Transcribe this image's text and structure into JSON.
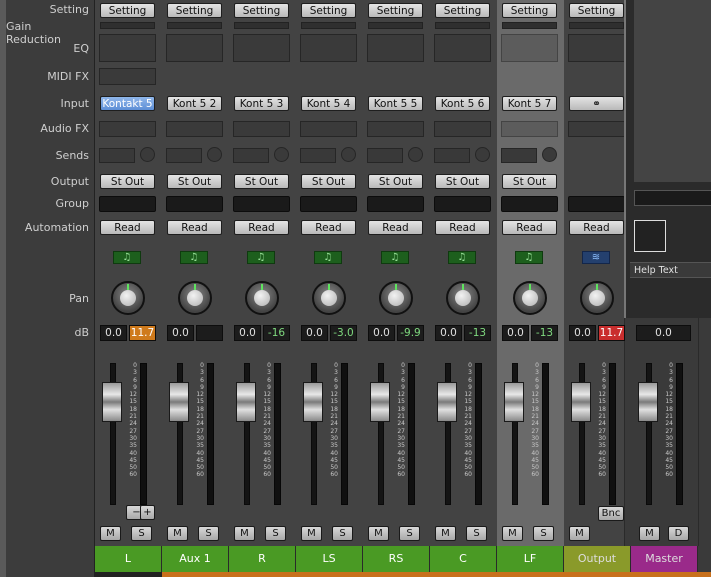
{
  "row_labels": [
    "Setting",
    "Gain Reduction",
    "EQ",
    "MIDI FX",
    "Input",
    "Audio FX",
    "Sends",
    "Output",
    "Group",
    "Automation",
    "Pan",
    "dB"
  ],
  "scale": [
    "0",
    "3",
    "6",
    "9",
    "12",
    "15",
    "18",
    "21",
    "24",
    "27",
    "30",
    "35",
    "40",
    "45",
    "50",
    "60"
  ],
  "strips": [
    {
      "name": "L",
      "setting": "Setting",
      "input": "Kontakt 5",
      "output": "St Out",
      "automation": "Read",
      "db_left": "0.0",
      "db_right": "11.7",
      "midi_fx": true,
      "selected_input": true
    },
    {
      "name": "Aux 1",
      "setting": "Setting",
      "input": "Kont 5 2",
      "output": "St Out",
      "automation": "Read",
      "db_left": "0.0",
      "db_right": ""
    },
    {
      "name": "R",
      "setting": "Setting",
      "input": "Kont 5 3",
      "output": "St Out",
      "automation": "Read",
      "db_left": "0.0",
      "db_right": "-16"
    },
    {
      "name": "LS",
      "setting": "Setting",
      "input": "Kont 5 4",
      "output": "St Out",
      "automation": "Read",
      "db_left": "0.0",
      "db_right": "-3.0"
    },
    {
      "name": "RS",
      "setting": "Setting",
      "input": "Kont 5 5",
      "output": "St Out",
      "automation": "Read",
      "db_left": "0.0",
      "db_right": "-9.9"
    },
    {
      "name": "C",
      "setting": "Setting",
      "input": "Kont 5 6",
      "output": "St Out",
      "automation": "Read",
      "db_left": "0.0",
      "db_right": "-13"
    },
    {
      "name": "LF",
      "setting": "Setting",
      "input": "Kont 5 7",
      "output": "St Out",
      "automation": "Read",
      "db_left": "0.0",
      "db_right": "-13"
    },
    {
      "name": "Output",
      "setting": "Setting",
      "input": "",
      "output": "",
      "automation": "Read",
      "db_left": "0.0",
      "db_right": "11.7"
    }
  ],
  "master": {
    "name": "Master",
    "db": "0.0",
    "m": "M",
    "d": "D"
  },
  "buttons": {
    "m": "M",
    "s": "S",
    "bnc": "Bnc",
    "minus": "−",
    "plus": "+"
  },
  "help_text": "Help Text",
  "icons": {
    "midi": "music-note-icon",
    "audio": "waveform-icon"
  },
  "colors": {
    "track_green": "#4a9a24",
    "output_olive": "#8a9a2a",
    "master_purple": "#9a2a8a",
    "selected_input": "#6b9be0",
    "db_orange": "#cf7a1c",
    "db_red": "#c92e2e"
  }
}
